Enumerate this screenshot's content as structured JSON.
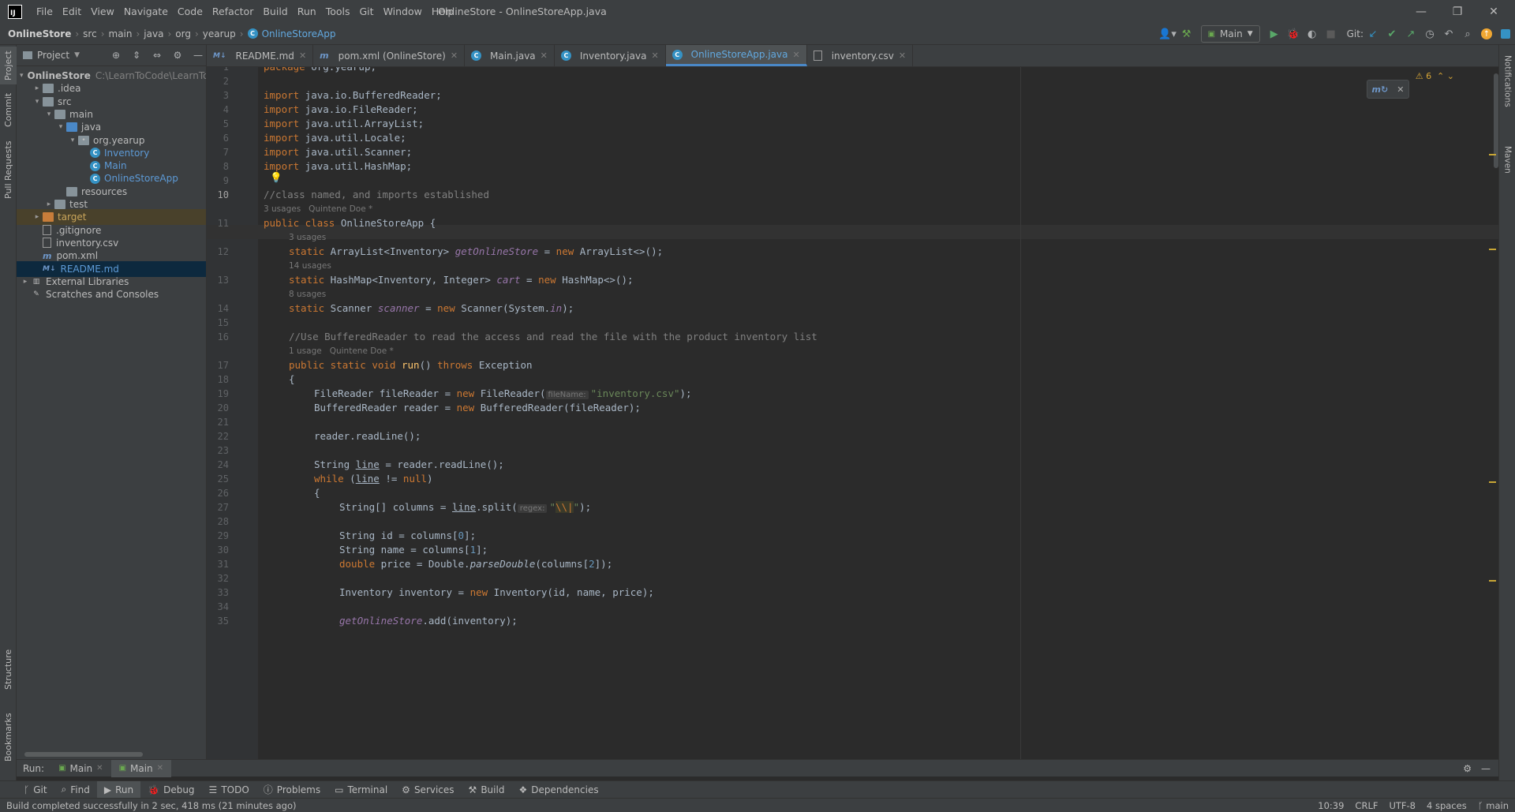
{
  "window": {
    "title": "OnlineStore - OnlineStoreApp.java",
    "app_logo_text": "IJ"
  },
  "menu": [
    "File",
    "Edit",
    "View",
    "Navigate",
    "Code",
    "Refactor",
    "Build",
    "Run",
    "Tools",
    "Git",
    "Window",
    "Help"
  ],
  "breadcrumb": [
    "OnlineStore",
    "src",
    "main",
    "java",
    "org",
    "yearup",
    "OnlineStoreApp"
  ],
  "toolbar": {
    "run_config": "Main",
    "git_label": "Git:"
  },
  "left_strip": [
    "Project",
    "Commit",
    "Pull Requests",
    "Structure",
    "Bookmarks"
  ],
  "right_strip": [
    "Notifications",
    "Maven"
  ],
  "project_panel": {
    "title": "Project",
    "tree": [
      {
        "label": "OnlineStore",
        "extra": "C:\\LearnToCode\\LearnToC",
        "indent": 0,
        "arrow": "▾",
        "icon": "folder",
        "bold": true
      },
      {
        "label": ".idea",
        "indent": 1,
        "arrow": "▸",
        "icon": "folder"
      },
      {
        "label": "src",
        "indent": 1,
        "arrow": "▾",
        "icon": "folder"
      },
      {
        "label": "main",
        "indent": 2,
        "arrow": "▾",
        "icon": "folder"
      },
      {
        "label": "java",
        "indent": 3,
        "arrow": "▾",
        "icon": "folder-blue"
      },
      {
        "label": "org.yearup",
        "indent": 4,
        "arrow": "▾",
        "icon": "package"
      },
      {
        "label": "Inventory",
        "indent": 5,
        "arrow": "",
        "icon": "class",
        "color": "#5d9ad6"
      },
      {
        "label": "Main",
        "indent": 5,
        "arrow": "",
        "icon": "class",
        "color": "#5d9ad6"
      },
      {
        "label": "OnlineStoreApp",
        "indent": 5,
        "arrow": "",
        "icon": "class",
        "color": "#5d9ad6"
      },
      {
        "label": "resources",
        "indent": 3,
        "arrow": "",
        "icon": "folder"
      },
      {
        "label": "test",
        "indent": 2,
        "arrow": "▸",
        "icon": "folder"
      },
      {
        "label": "target",
        "indent": 1,
        "arrow": "▸",
        "icon": "folder-orange",
        "color": "#c9a55a",
        "excluded": true
      },
      {
        "label": ".gitignore",
        "indent": 1,
        "arrow": "",
        "icon": "file"
      },
      {
        "label": "inventory.csv",
        "indent": 1,
        "arrow": "",
        "icon": "file"
      },
      {
        "label": "pom.xml",
        "indent": 1,
        "arrow": "",
        "icon": "maven"
      },
      {
        "label": "README.md",
        "indent": 1,
        "arrow": "",
        "icon": "md",
        "color": "#5d9ad6",
        "selected": true
      },
      {
        "label": "External Libraries",
        "indent": 0,
        "arrow": "▸",
        "icon": "lib"
      },
      {
        "label": "Scratches and Consoles",
        "indent": 0,
        "arrow": "",
        "icon": "scratch"
      }
    ]
  },
  "tabs": [
    {
      "label": "README.md",
      "icon": "md"
    },
    {
      "label": "pom.xml (OnlineStore)",
      "icon": "maven"
    },
    {
      "label": "Main.java",
      "icon": "class"
    },
    {
      "label": "Inventory.java",
      "icon": "class"
    },
    {
      "label": "OnlineStoreApp.java",
      "icon": "class",
      "active": true
    },
    {
      "label": "inventory.csv",
      "icon": "file"
    }
  ],
  "editor": {
    "warnings": "6",
    "hints": {
      "h1": "3 usages   Quintene Doe *",
      "h2": "3 usages",
      "h3": "14 usages",
      "h4": "8 usages",
      "h5": "1 usage   Quintene Doe *"
    },
    "inlay": {
      "fileName": "fileName:",
      "regex": "regex:"
    },
    "line_numbers": [
      "1",
      "2",
      "3",
      "4",
      "5",
      "6",
      "7",
      "8",
      "9",
      "10",
      "11",
      "12",
      "13",
      "14",
      "15",
      "16",
      "17",
      "18",
      "19",
      "20",
      "21",
      "22",
      "23",
      "24",
      "25",
      "26",
      "27",
      "28",
      "29",
      "30",
      "31",
      "32",
      "33",
      "34",
      "35"
    ]
  },
  "run_bar": {
    "label": "Run:",
    "tabs": [
      "Main",
      "Main"
    ]
  },
  "bottom_tools": [
    "Git",
    "Find",
    "Run",
    "Debug",
    "TODO",
    "Problems",
    "Terminal",
    "Services",
    "Build",
    "Dependencies"
  ],
  "status": {
    "message": "Build completed successfully in 2 sec, 418 ms (21 minutes ago)",
    "position": "10:39",
    "line_sep": "CRLF",
    "encoding": "UTF-8",
    "indent": "4 spaces",
    "branch": "main"
  }
}
